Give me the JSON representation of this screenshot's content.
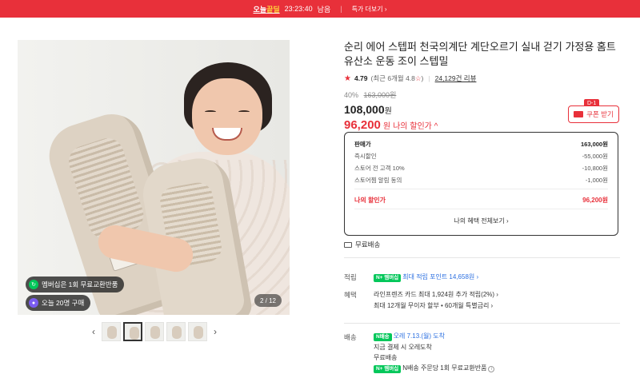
{
  "topbar": {
    "brand_prefix": "오늘",
    "brand_highlight": "끝딜",
    "timer": "23:23:40",
    "timer_suffix": "남음",
    "more": "특가 더보기 ›"
  },
  "gallery": {
    "badge_membership": "멤버십은 1회 무료교환반품",
    "badge_today": "오늘 20명 구매",
    "counter": "2 / 12"
  },
  "product": {
    "title": "순리 에어 스텝퍼 천국의계단 계단오르기 실내 걷기 가정용 홈트 유산소 운동 조이 스텝밀",
    "rating": "4.79",
    "rating_recent": "(최근 6개월 4.8",
    "rating_recent_star": "☆",
    "rating_recent_close": ")",
    "reviews": "24,129건 리뷰",
    "discount_rate": "40%",
    "original_price": "163,000원",
    "price": "108,000",
    "price_unit": "원",
    "my_price": "96,200",
    "my_price_unit": "원",
    "my_price_label": "나의 할인가 ^",
    "coupon_tag": "D-1",
    "coupon_label": "쿠폰 받기"
  },
  "breakdown": {
    "rows": [
      {
        "label": "판매가",
        "value": "163,000원"
      },
      {
        "label": "즉시할인",
        "value": "-55,000원"
      },
      {
        "label": "스토어 전 고객 10%",
        "value": "-10,800원"
      },
      {
        "label": "스토어찜 알림 동의",
        "value": "-1,000원"
      }
    ],
    "mine_label": "나의 할인가",
    "mine_value": "96,200원",
    "benefit_button": "나의 혜택 전체보기 ›"
  },
  "shipping_free": "무료배송",
  "points": {
    "label": "적립",
    "badge": "N+ 멤버십",
    "text": "최대 적립 포인트 14,658원 ›"
  },
  "benefits": {
    "label": "혜택",
    "line1": "라인프렌즈 카드 최대 1,924원 추가 적립(2%) ›",
    "line2": "최대 12개월 무이자 할부 • 60개월 특별금리 ›"
  },
  "delivery": {
    "label": "배송",
    "badge": "N배송",
    "eta": "오레 7.13.(월) 도착",
    "line2": "지금 결제 시 오레도착",
    "line3": "무료배송",
    "membership_badge": "N+ 멤버십",
    "line4": "N배송 주문당 1회 무료교환반품",
    "info": "i"
  }
}
